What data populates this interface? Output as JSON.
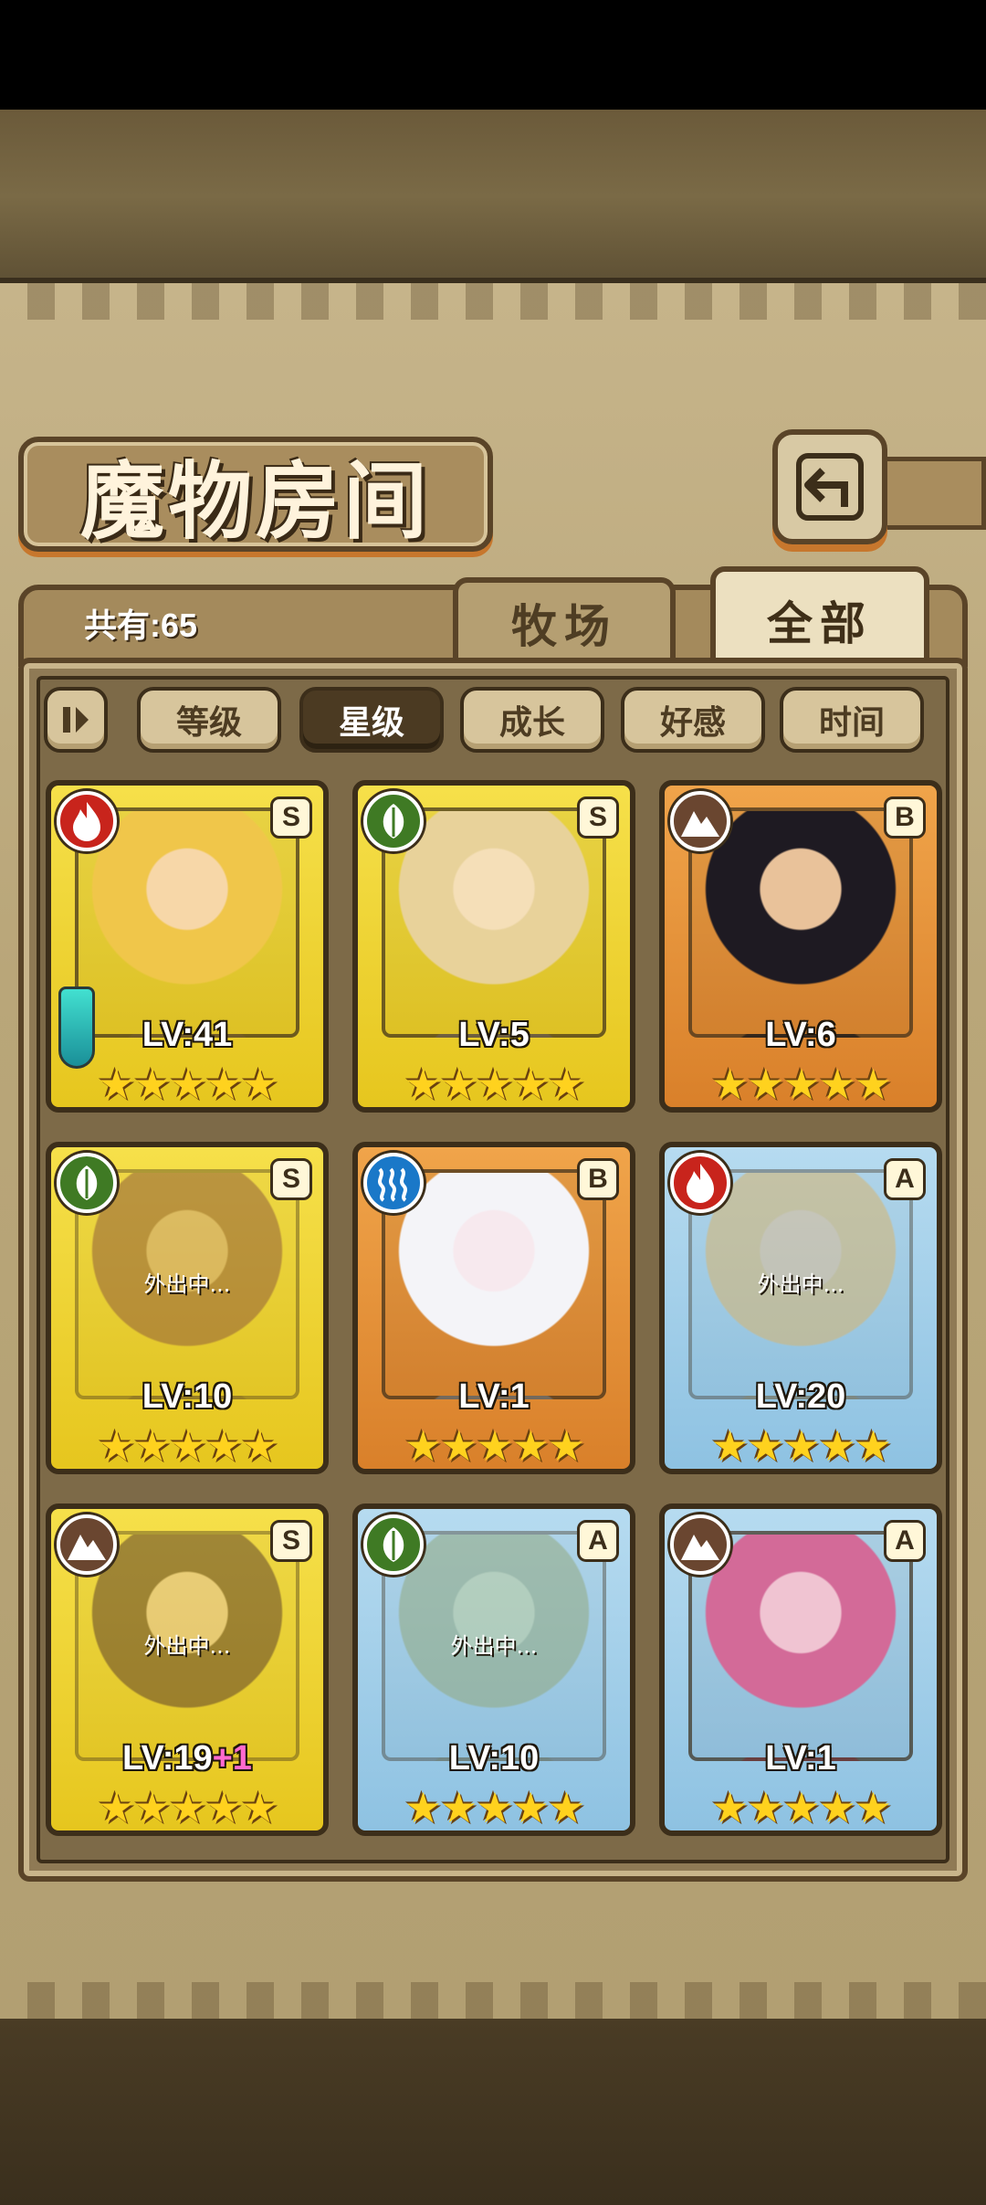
{
  "title": "魔物房间",
  "count_label": "共有:65",
  "tabs": {
    "pasture": "牧场",
    "all": "全部"
  },
  "sort": {
    "toggle_icon": "sort-toggle-icon",
    "buttons": [
      "等级",
      "星级",
      "成长",
      "好感",
      "时间"
    ],
    "active": "星级"
  },
  "cards": [
    {
      "rank": "S",
      "element": "fire",
      "level": "LV:41",
      "bonus": "",
      "away": false,
      "frame": "gold",
      "weapon": true
    },
    {
      "rank": "S",
      "element": "leaf",
      "level": "LV:5",
      "bonus": "",
      "away": false,
      "frame": "gold",
      "weapon": false
    },
    {
      "rank": "B",
      "element": "earth",
      "level": "LV:6",
      "bonus": "",
      "away": false,
      "frame": "bronze",
      "weapon": false
    },
    {
      "rank": "S",
      "element": "leaf",
      "level": "LV:10",
      "bonus": "",
      "away": true,
      "frame": "gold",
      "weapon": false
    },
    {
      "rank": "B",
      "element": "water",
      "level": "LV:1",
      "bonus": "",
      "away": false,
      "frame": "bronze",
      "weapon": false
    },
    {
      "rank": "A",
      "element": "fire",
      "level": "LV:20",
      "bonus": "",
      "away": true,
      "frame": "blue",
      "weapon": false
    },
    {
      "rank": "S",
      "element": "earth",
      "level": "LV:19",
      "bonus": "+1",
      "away": true,
      "frame": "gold",
      "weapon": false
    },
    {
      "rank": "A",
      "element": "leaf",
      "level": "LV:10",
      "bonus": "",
      "away": true,
      "frame": "blue",
      "weapon": false
    },
    {
      "rank": "A",
      "element": "earth",
      "level": "LV:1",
      "bonus": "",
      "away": false,
      "frame": "blue",
      "weapon": false
    }
  ],
  "away_label": "外出中...",
  "stars_label": "★★★★★",
  "colors": {
    "accent": "#c7772d",
    "frame_dark": "#3c2e1a",
    "parchment": "#b9a679"
  }
}
